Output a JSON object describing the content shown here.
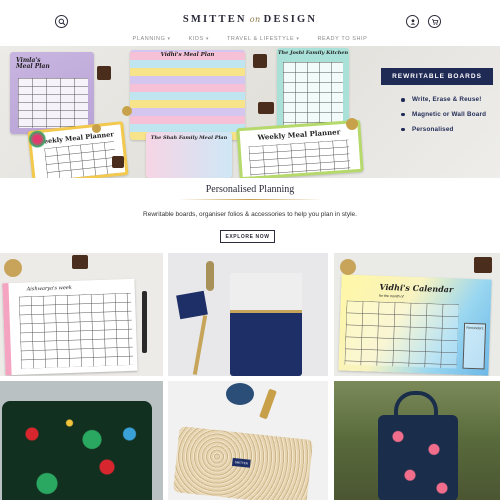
{
  "header": {
    "logo_left": "SMITTEN",
    "logo_mid": "on",
    "logo_right": "DESIGN",
    "icons": {
      "search": "search-icon",
      "account": "user-icon",
      "cart": "cart-icon"
    }
  },
  "nav": {
    "items": [
      {
        "label": "PLANNING"
      },
      {
        "label": "KIDS"
      },
      {
        "label": "TRAVEL & LIFESTYLE"
      },
      {
        "label": "READY TO SHIP"
      }
    ]
  },
  "hero": {
    "cards": {
      "meal_plan": "Vimla's Meal Plan",
      "weekly_1": "Weekly Meal Planner",
      "vidhi_plan": "Vidhi's Meal Plan",
      "shah_plan": "The Shah Family Meal Plan",
      "weekly_2": "Weekly Meal Planner",
      "kitchen": "The Joshi Family Kitchen"
    },
    "banner": "REWRITABLE BOARDS",
    "bullets": [
      "Write, Erase & Reuse!",
      "Magnetic or Wall Board",
      "Personalised"
    ]
  },
  "section": {
    "title": "Personalised Planning",
    "subtitle": "Rewritable boards, organiser folios & accessories to help you plan in style.",
    "button": "EXPLORE NOW"
  },
  "tiles": {
    "t1_title": "Aishwarya's week",
    "t3_title": "Vidhi's Calendar",
    "t3_sub": "for the month of",
    "t3_note": "Reminders",
    "t5_label": "SMITTEN"
  },
  "colors": {
    "navy": "#1f2a55",
    "gold": "#c8a050"
  }
}
